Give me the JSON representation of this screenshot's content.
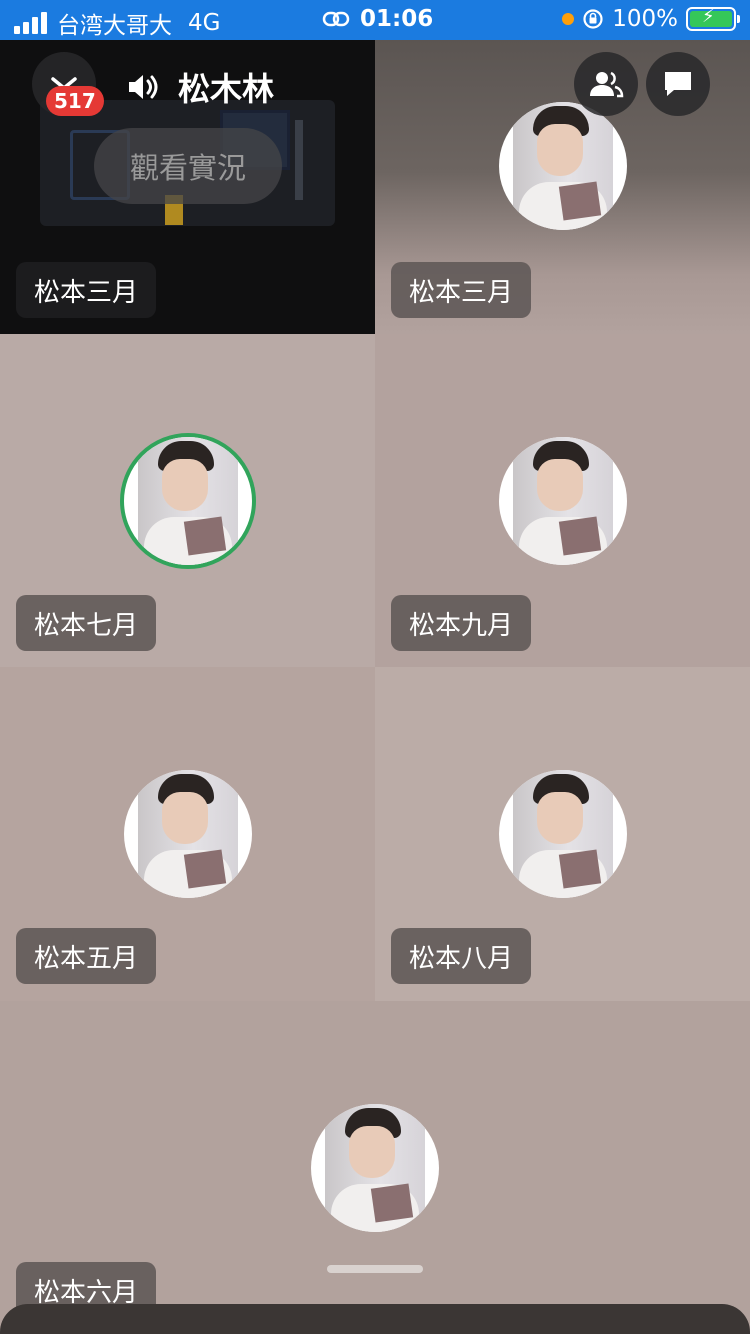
{
  "status_bar": {
    "carrier": "台湾大哥大",
    "network": "4G",
    "time": "01:06",
    "battery": "100%"
  },
  "header": {
    "room_name": "松木林",
    "notification_count": "517",
    "watch_live_label": "觀看實況"
  },
  "participants": [
    {
      "name": "松本三月"
    },
    {
      "name": "松本三月"
    },
    {
      "name": "松本七月"
    },
    {
      "name": "松本九月"
    },
    {
      "name": "松本五月"
    },
    {
      "name": "松本八月"
    },
    {
      "name": "松本六月"
    }
  ],
  "icons": {
    "collapse": "chevron-down-icon",
    "speaker": "speaker-icon",
    "members": "people-icon",
    "chat": "chat-bubble-icon"
  },
  "colors": {
    "status_bar": "#1b7be0",
    "speaking_ring": "#31a45b",
    "badge": "#e53935"
  }
}
